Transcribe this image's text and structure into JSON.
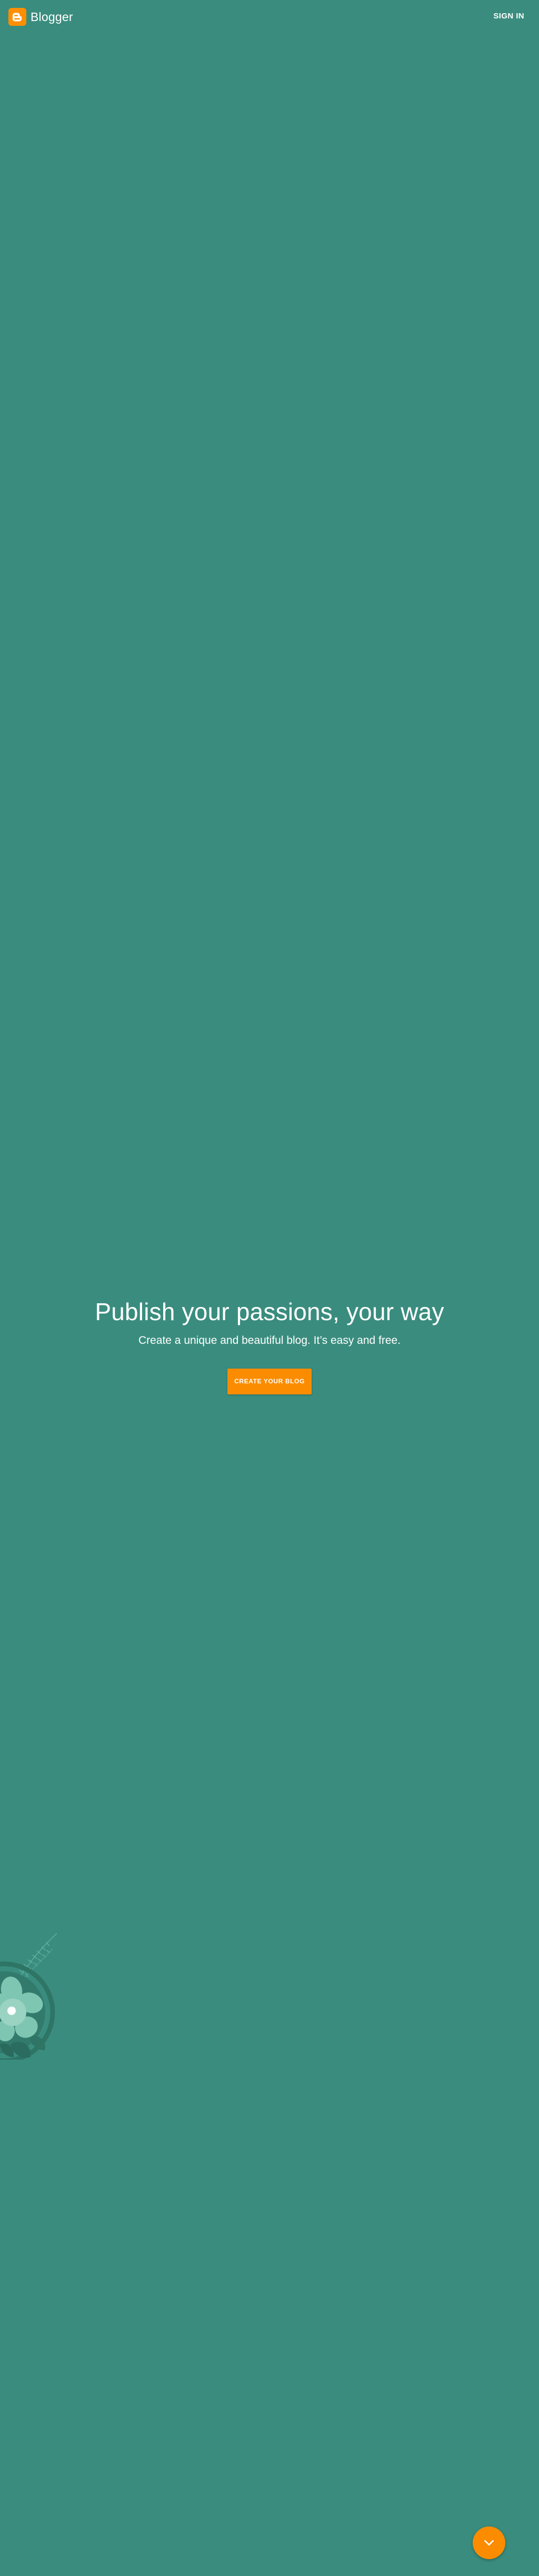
{
  "header": {
    "brand_name": "Blogger",
    "sign_in_label": "SIGN IN"
  },
  "hero": {
    "title": "Publish your passions, your way",
    "subtitle": "Create a unique and beautiful blog. It’s easy and free.",
    "cta_label": "CREATE YOUR BLOG"
  },
  "icons": {
    "logo": "blogger-logo-icon",
    "scroll": "chevron-down-icon",
    "illustration": "flower-leaves-illustration"
  },
  "colors": {
    "background": "#3a8d7e",
    "accent": "#fb8c00",
    "text": "#ffffff"
  }
}
